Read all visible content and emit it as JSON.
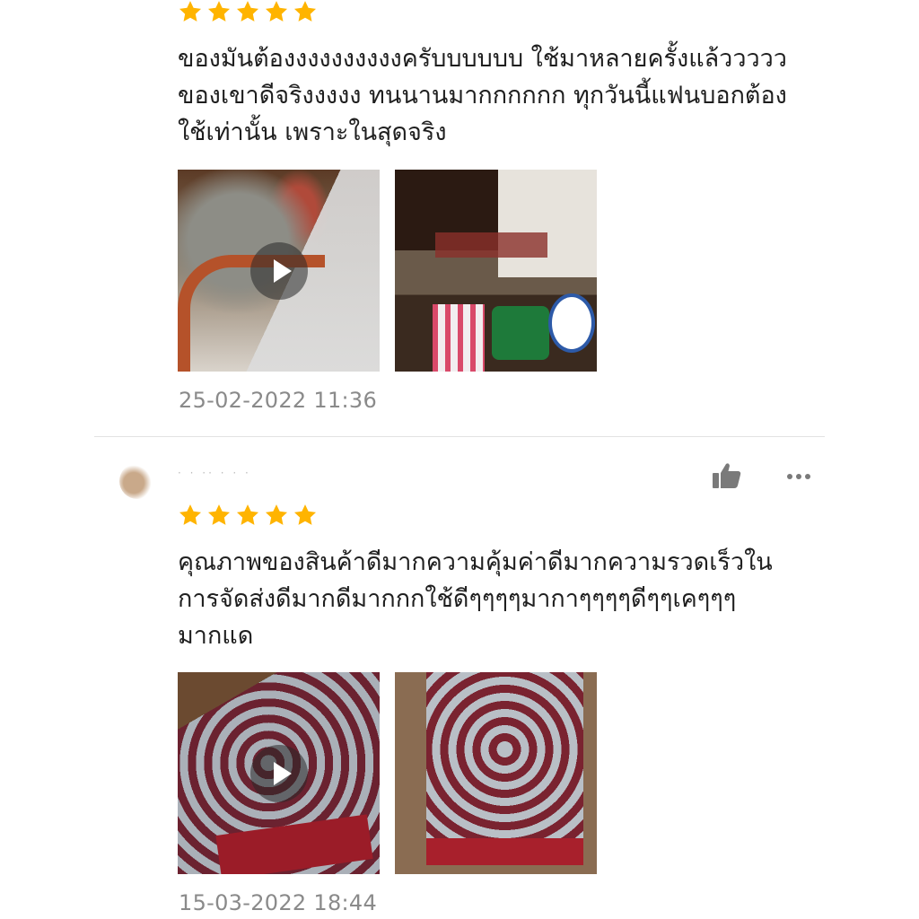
{
  "colors": {
    "star": "#FFB400",
    "date": "#8A8A8A",
    "divider": "#E2E2E2",
    "icon": "#7A7A7A"
  },
  "reviews": [
    {
      "rating": 5,
      "text_lines": [
        "ของมันต้องงงงงงงงงงครับบบบบบ ใช้มาหลายครั้งแล้ววววว",
        "ของเขาดีจริงงงงง ทนนานมากกกกกก ทุกวันนี้แฟนบอกต้อง",
        "ใช้เท่านั้น เพราะในสุดจริง"
      ],
      "media": [
        {
          "type": "video",
          "icon": "play-icon"
        },
        {
          "type": "image"
        }
      ],
      "date": "25-02-2022 11:36"
    },
    {
      "username": "· ·  ·· ·   · ·",
      "like_icon": "thumbs-up-icon",
      "more_icon": "more-horizontal-icon",
      "rating": 5,
      "text_lines": [
        "คุณภาพของสินค้าดีมากความคุ้มค่าดีมากความรวดเร็วใน",
        "การจัดส่งดีมากดีมากกกใช้ดีๆๆๆๆมากาๆๆๆๆดีๆๆเคๆๆๆ",
        "มากแด"
      ],
      "media": [
        {
          "type": "video",
          "icon": "play-icon"
        },
        {
          "type": "image"
        }
      ],
      "date": "15-03-2022 18:44"
    }
  ]
}
